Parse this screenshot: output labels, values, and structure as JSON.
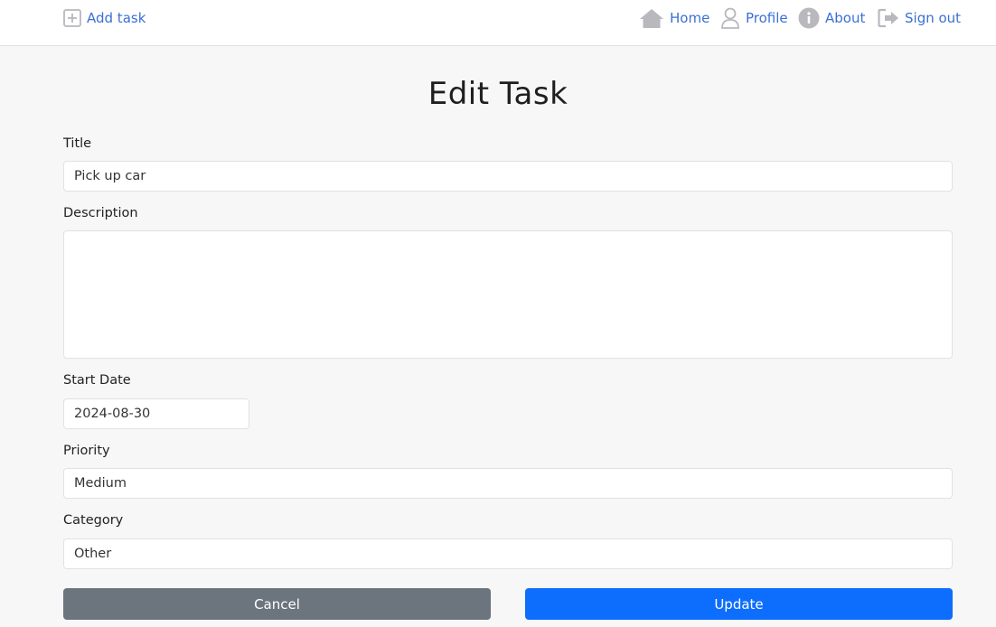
{
  "nav": {
    "add_task": "Add task",
    "home": "Home",
    "profile": "Profile",
    "about": "About",
    "sign_out": "Sign out"
  },
  "page": {
    "title": "Edit Task"
  },
  "form": {
    "title_label": "Title",
    "title_value": "Pick up car",
    "description_label": "Description",
    "description_value": "",
    "start_date_label": "Start Date",
    "start_date_value": "2024-08-30",
    "priority_label": "Priority",
    "priority_value": "Medium",
    "category_label": "Category",
    "category_value": "Other"
  },
  "buttons": {
    "cancel": "Cancel",
    "update": "Update"
  },
  "colors": {
    "link": "#3b6fd6",
    "icon": "#b8b8bd",
    "primary": "#0d6efd",
    "secondary": "#6c757d",
    "background": "#f7f7f7"
  },
  "icons": {
    "add_task": "plus-square-icon",
    "home": "home-icon",
    "profile": "user-icon",
    "about": "info-circle-icon",
    "sign_out": "sign-out-icon"
  }
}
